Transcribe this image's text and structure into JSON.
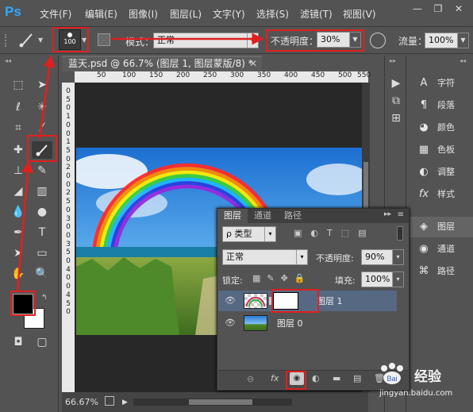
{
  "app": {
    "logo": "Ps"
  },
  "menu": [
    "文件(F)",
    "编辑(E)",
    "图像(I)",
    "图层(L)",
    "文字(Y)",
    "选择(S)",
    "滤镜(T)",
    "视图(V)"
  ],
  "options": {
    "brush_size": "100",
    "mode_label": "模式：",
    "mode_value": "正常",
    "opacity_label": "不透明度：",
    "opacity_value": "30%",
    "flow_label": "流量：",
    "flow_value": "100%"
  },
  "document": {
    "tab_title": "蓝天.psd @ 66.7% (图层 1, 图层蒙版/8) *",
    "zoom": "66.67%",
    "ruler_h": [
      "50",
      "100",
      "150",
      "200",
      "250",
      "300",
      "350",
      "400",
      "450",
      "500",
      "550"
    ],
    "ruler_v": [
      "0",
      "5",
      "0",
      "1",
      "0",
      "0",
      "1",
      "5",
      "0",
      "2",
      "0",
      "0",
      "2",
      "5",
      "0",
      "3",
      "0",
      "0",
      "3",
      "5",
      "0",
      "4",
      "0",
      "0",
      "4",
      "5",
      "0"
    ]
  },
  "right_panel": {
    "items": [
      {
        "icon": "A",
        "label": "字符"
      },
      {
        "icon": "¶",
        "label": "段落"
      },
      {
        "icon": "◕",
        "label": "颜色"
      },
      {
        "icon": "▦",
        "label": "色板"
      },
      {
        "icon": "◐",
        "label": "调整"
      },
      {
        "icon": "fx",
        "label": "样式"
      },
      {
        "icon": "◈",
        "label": "图层"
      },
      {
        "icon": "◉",
        "label": "通道"
      },
      {
        "icon": "⌘",
        "label": "路径"
      }
    ]
  },
  "layers_panel": {
    "tabs": [
      "图层",
      "通道",
      "路径"
    ],
    "filter_label": "ρ 类型",
    "blend_mode": "正常",
    "opacity_label": "不透明度:",
    "opacity_value": "90%",
    "lock_label": "锁定:",
    "fill_label": "填充:",
    "fill_value": "100%",
    "layers": [
      {
        "name": "图层 1",
        "selected": true
      },
      {
        "name": "图层 0",
        "selected": false
      }
    ]
  },
  "watermark": {
    "brand": "Baidu",
    "site_name": "经验",
    "url": "jingyan.baidu.com"
  }
}
